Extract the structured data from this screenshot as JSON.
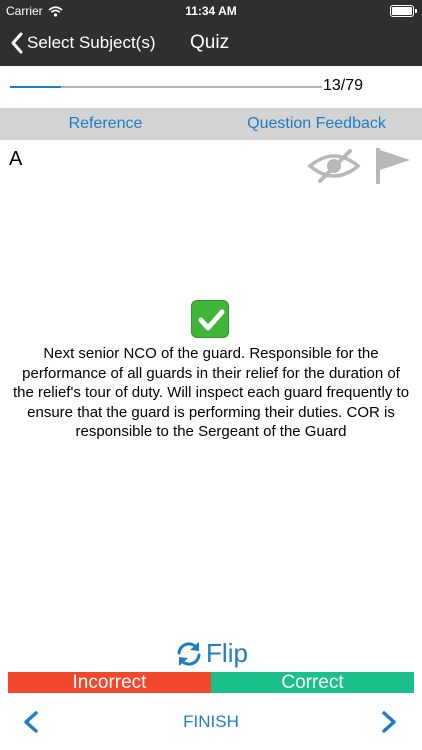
{
  "status_bar": {
    "carrier": "Carrier",
    "time": "11:34 AM"
  },
  "nav": {
    "back_label": "Select Subject(s)",
    "title": "Quiz"
  },
  "progress": {
    "current": 13,
    "total": 79,
    "label": "13/79",
    "fraction": 0.165
  },
  "tabs": [
    {
      "label": "Reference"
    },
    {
      "label": "Question Feedback"
    }
  ],
  "card": {
    "side_label": "A",
    "answer_text": "Next senior NCO of the guard. Responsible for the performance of all guards in their relief for the duration of the relief's tour of duty. Will inspect each guard frequently to ensure that the guard is performing their duties. COR is responsible to the Sergeant of the Guard"
  },
  "actions": {
    "flip_label": "Flip",
    "incorrect_label": "Incorrect",
    "correct_label": "Correct",
    "finish_label": "FINISH"
  },
  "icons": {
    "wifi": "wifi-icon",
    "battery": "battery-icon",
    "back": "chevron-left-icon",
    "hide": "eye-slash-icon",
    "flag": "flag-icon",
    "check": "check-mark-icon",
    "flip": "refresh-icon",
    "prev": "chevron-left-icon",
    "next": "chevron-right-icon"
  },
  "colors": {
    "bar_dark": "#2f2f2f",
    "accent_blue": "#1d7ec4",
    "tab_gray": "#d3d3d3",
    "incorrect_red": "#f2472a",
    "correct_green": "#1bbf8a",
    "check_green": "#3fb63a",
    "icon_gray": "#b8b8b8"
  }
}
